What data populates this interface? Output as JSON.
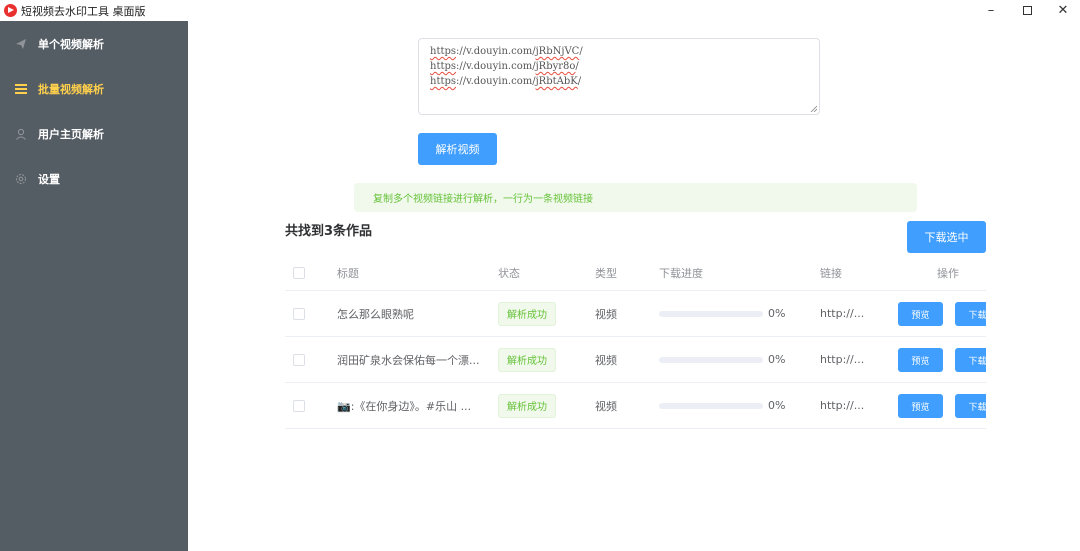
{
  "window": {
    "title": "短视频去水印工具 桌面版",
    "min_label": "–",
    "close_label": "✕"
  },
  "sidebar": {
    "items": [
      {
        "label": "单个视频解析",
        "icon": "paper-plane-icon",
        "active": false
      },
      {
        "label": "批量视频解析",
        "icon": "list-icon",
        "active": true
      },
      {
        "label": "用户主页解析",
        "icon": "user-icon",
        "active": false
      },
      {
        "label": "设置",
        "icon": "gear-icon",
        "active": false
      }
    ],
    "active_color": "#ffd04b",
    "background": "#545c64"
  },
  "input": {
    "lines": [
      {
        "prefix": "https",
        "rest": "://v.douyin.com/",
        "code": "jRbNjVC",
        "end": "/"
      },
      {
        "prefix": "https",
        "rest": "://v.douyin.com/",
        "code": "jRbyr8o",
        "end": "/"
      },
      {
        "prefix": "https",
        "rest": "://v.douyin.com/",
        "code": "jRbtAbK",
        "end": "/"
      }
    ]
  },
  "actions": {
    "parse_label": "解析视频",
    "download_selected_label": "下载选中"
  },
  "tip": "复制多个视频链接进行解析，一行为一条视频链接",
  "results": {
    "count_label": "共找到3条作品",
    "columns": [
      "标题",
      "状态",
      "类型",
      "下载进度",
      "链接",
      "操作"
    ],
    "rows": [
      {
        "title": "怎么那么眼熟呢",
        "status": "解析成功",
        "type": "视频",
        "progress": 0,
        "progress_text": "0%",
        "link": "http://...",
        "preview": "预览",
        "download": "下载"
      },
      {
        "title": "润田矿泉水会保佑每一个漂...",
        "status": "解析成功",
        "type": "视频",
        "progress": 0,
        "progress_text": "0%",
        "link": "http://...",
        "preview": "预览",
        "download": "下载"
      },
      {
        "title": "📷:《在你身边》。#乐山 ...",
        "status": "解析成功",
        "type": "视频",
        "progress": 0,
        "progress_text": "0%",
        "link": "http://...",
        "preview": "预览",
        "download": "下载"
      }
    ]
  },
  "colors": {
    "primary": "#409eff",
    "success": "#67c23a"
  }
}
